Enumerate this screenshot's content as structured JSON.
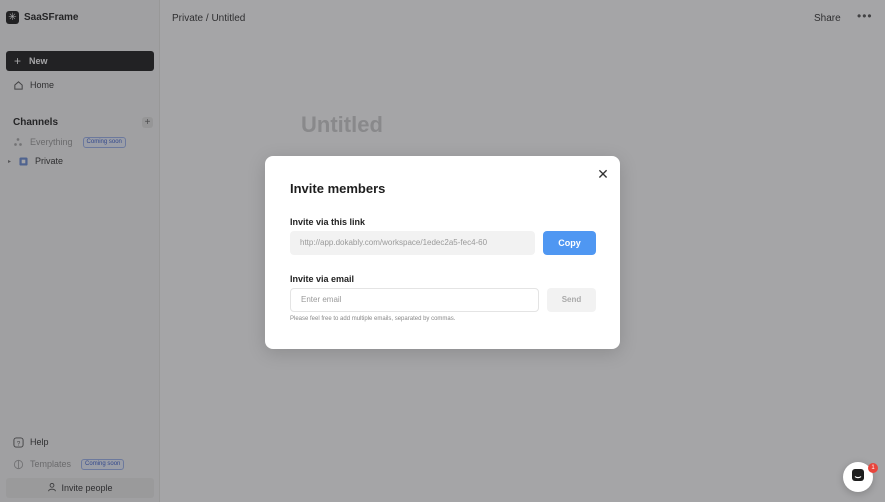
{
  "brand": {
    "name": "SaaSFrame"
  },
  "sidebar": {
    "new_label": "New",
    "home_label": "Home",
    "channels_title": "Channels",
    "channels": [
      {
        "label": "Everything",
        "badge": "Coming soon"
      },
      {
        "label": "Private"
      }
    ],
    "help_label": "Help",
    "templates_label": "Templates",
    "templates_badge": "Coming soon",
    "invite_people_label": "Invite people"
  },
  "header": {
    "breadcrumb": "Private / Untitled",
    "share_label": "Share",
    "more_label": "•••"
  },
  "document": {
    "title": "Untitled"
  },
  "modal": {
    "title": "Invite members",
    "link_label": "Invite via this link",
    "link_value": "http://app.dokably.com/workspace/1edec2a5-fec4-60",
    "copy_label": "Copy",
    "email_label": "Invite via email",
    "email_placeholder": "Enter email",
    "send_label": "Send",
    "hint": "Please feel free to add multiple emails, separated by commas.",
    "close_label": "✕"
  },
  "chat": {
    "badge_count": "1"
  },
  "colors": {
    "primary": "#4f97f2",
    "dark": "#1e1e1e",
    "notification": "#e8453c"
  }
}
